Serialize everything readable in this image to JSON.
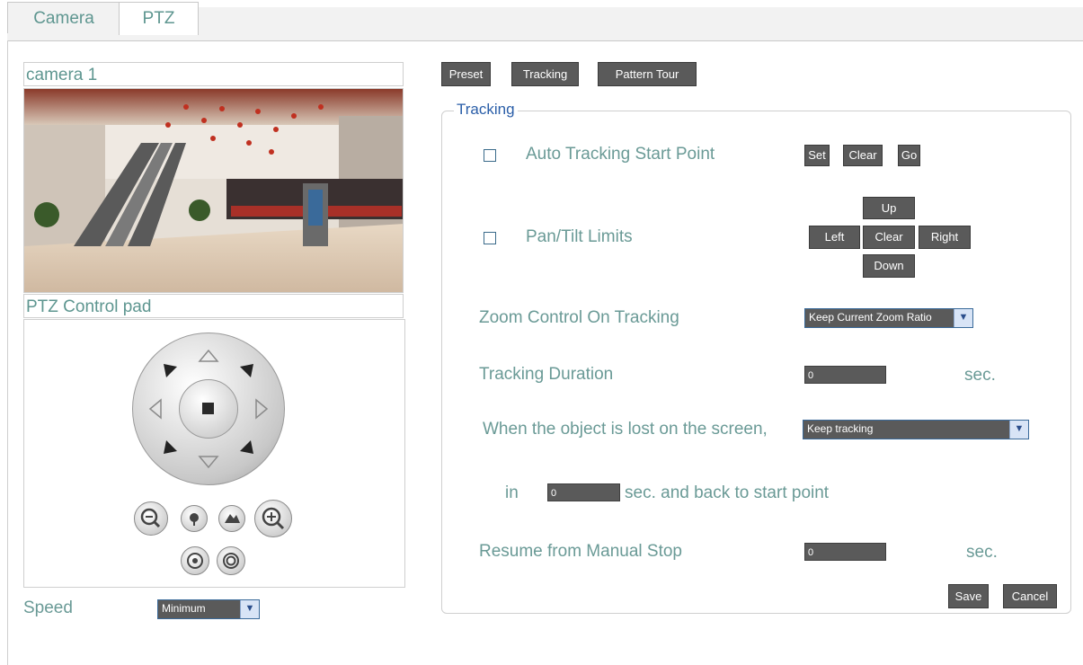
{
  "tabs": [
    {
      "label": "Camera",
      "active": false
    },
    {
      "label": "PTZ",
      "active": true
    }
  ],
  "left": {
    "camera_title": "camera 1",
    "pad_title": "PTZ Control pad",
    "speed_label": "Speed",
    "speed_value": "Minimum"
  },
  "modes": [
    "Preset",
    "Tracking",
    "Pattern Tour"
  ],
  "tracking": {
    "legend": "Tracking",
    "auto_start_label": "Auto Tracking Start Point",
    "auto_start_buttons": {
      "set": "Set",
      "clear": "Clear",
      "go": "Go"
    },
    "pan_tilt_label": "Pan/Tilt Limits",
    "pan_tilt_buttons": {
      "up": "Up",
      "left": "Left",
      "clear": "Clear",
      "right": "Right",
      "down": "Down"
    },
    "zoom_label": "Zoom Control On Tracking",
    "zoom_value": "Keep Current Zoom Ratio",
    "duration_label": "Tracking Duration",
    "duration_value": "0",
    "duration_unit": "sec.",
    "lost_label": "When the object is lost on the screen,",
    "lost_value": "Keep tracking",
    "in_label": "in",
    "in_value": "0",
    "in_suffix": "sec. and back to start point",
    "resume_label": "Resume from Manual Stop",
    "resume_value": "0",
    "resume_unit": "sec.",
    "save": "Save",
    "cancel": "Cancel"
  },
  "colors": {
    "label": "#6a9a96",
    "legend": "#2a5ea8",
    "button": "#5a5a5a"
  }
}
